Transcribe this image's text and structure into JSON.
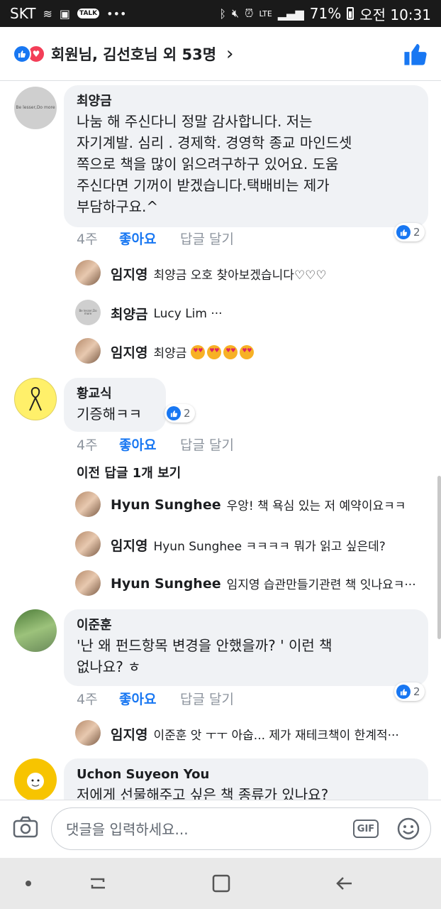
{
  "status_bar": {
    "carrier": "SKT",
    "talk_badge": "TALK",
    "network": "LTE",
    "battery": "71%",
    "time": "오전 10:31",
    "icons": [
      "wifi-calling-icon",
      "gallery-icon",
      "kakaotalk-icon",
      "more-dots-icon",
      "bluetooth-icon",
      "mute-icon",
      "alarm-icon",
      "signal-icon",
      "battery-icon"
    ]
  },
  "header": {
    "title": "회원님, 김선호님 외 53명",
    "reactions": [
      "like",
      "love"
    ],
    "chevron": "›"
  },
  "comments": [
    {
      "author": "최양금",
      "avatar_text": "Be lesser,Do more",
      "text": "나눔 해  주신다니  정말 감사합니다. 저는\n자기계발. 심리 . 경제학. 경영학  종교  마인드셋\n쪽으로  책을 많이  읽으려구하구 있어요. 도움\n주신다면  기꺼이  받겠습니다.택배비는 제가\n부담하구요.^",
      "time": "4주",
      "like_label": "좋아요",
      "reply_label": "답글 달기",
      "reaction_count": "2",
      "replies": [
        {
          "author": "임지영",
          "text": "최양금 오호 찾아보겠습니다♡♡♡"
        },
        {
          "author": "최양금",
          "avatar_text": "Be lesser,Do more",
          "text": "Lucy  Lim ···"
        },
        {
          "author": "임지영",
          "text": "최양금",
          "emoji_count": 4
        }
      ]
    },
    {
      "author": "황교식",
      "text": "기증해ㅋㅋ",
      "time": "4주",
      "like_label": "좋아요",
      "reply_label": "답글 달기",
      "reaction_count": "2",
      "more_replies": "이전 답글 1개 보기",
      "replies": [
        {
          "author": "Hyun Sunghee",
          "text": "우앙! 책 욕심 있는 저 예약이요ㅋㅋ"
        },
        {
          "author": "임지영",
          "text": "Hyun Sunghee ㅋㅋㅋㅋ 뭐가 읽고 싶은데?"
        },
        {
          "author": "Hyun Sunghee",
          "text": "임지영 습관만들기관련 책 잇나요ㅋ···"
        }
      ]
    },
    {
      "author": "이준훈",
      "text": "'난 왜 펀드항목 변경을 안했을까? ' 이런 책\n없나요? ㅎ",
      "time": "4주",
      "like_label": "좋아요",
      "reply_label": "답글 달기",
      "reaction_count": "2",
      "replies": [
        {
          "author": "임지영",
          "text": "이준훈 앗 ㅜㅜ 아숩... 제가 재테크책이 한계적···"
        }
      ]
    },
    {
      "author": "Uchon Suyeon You",
      "text": "저에게 선물해주고 싶은 책 종류가 있나요?"
    }
  ],
  "composer": {
    "placeholder": "댓글을 입력하세요...",
    "gif_label": "GIF"
  },
  "colors": {
    "accent": "#1877f2",
    "bubble": "#f0f2f5",
    "love": "#f33e58"
  }
}
